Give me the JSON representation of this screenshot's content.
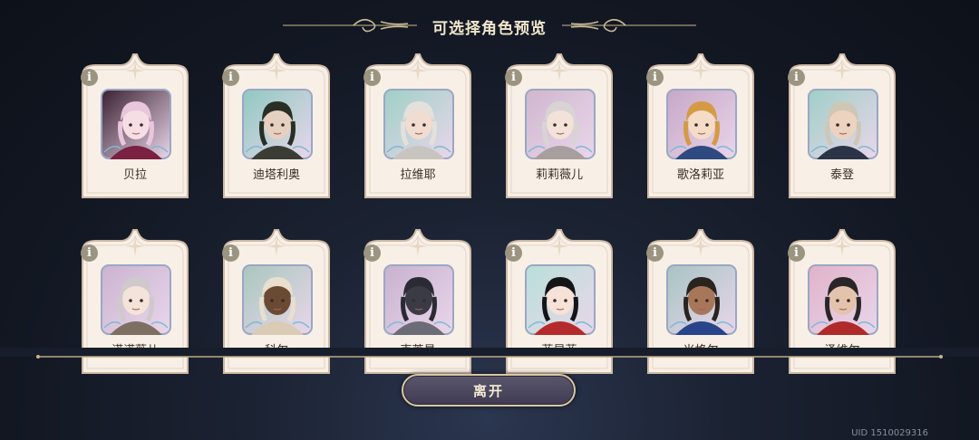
{
  "header": {
    "title": "可选择角色预览"
  },
  "characters_row1": [
    {
      "name": "贝拉",
      "info_label": "i",
      "portrait": "witch-pink-hair",
      "bg": "#3a2030",
      "hair": "#e8c6dc",
      "skin": "#f6dfe4",
      "accent": "#7a2040"
    },
    {
      "name": "迪塔利奥",
      "info_label": "i",
      "portrait": "dark-hair-man",
      "bg": "#8fc9c0",
      "hair": "#2a2f25",
      "skin": "#e6d0c0",
      "accent": "#3b3d35"
    },
    {
      "name": "拉维耶",
      "info_label": "i",
      "portrait": "white-hair-man",
      "bg": "#9ed0c6",
      "hair": "#e4e0dc",
      "skin": "#f0dcd0",
      "accent": "#c8c4c0"
    },
    {
      "name": "莉莉薇儿",
      "info_label": "i",
      "portrait": "silver-hair-fox-ears",
      "bg": "#cfb7ce",
      "hair": "#d8d4d4",
      "skin": "#f2e2d8",
      "accent": "#a89e9e"
    },
    {
      "name": "歌洛莉亚",
      "info_label": "i",
      "portrait": "blonde-woman",
      "bg": "#c6a7c7",
      "hair": "#d59a45",
      "skin": "#f4dcc6",
      "accent": "#2f4a80"
    },
    {
      "name": "泰登",
      "info_label": "i",
      "portrait": "grey-hair-knight",
      "bg": "#9fcfc7",
      "hair": "#cfc7b6",
      "skin": "#ecd3c0",
      "accent": "#2c3448"
    }
  ],
  "characters_row2": [
    {
      "name": "诺诺薇儿",
      "info_label": "i",
      "portrait": "silver-hair-cat-ears",
      "bg": "#cab3d0",
      "hair": "#cfc9cc",
      "skin": "#f3e3d8",
      "accent": "#7d6f62"
    },
    {
      "name": "科尔",
      "info_label": "i",
      "portrait": "hooded-dark-skin",
      "bg": "#a8c7bd",
      "hair": "#e8dfcf",
      "skin": "#6b4a33",
      "accent": "#d9cbb4"
    },
    {
      "name": "克莱曼",
      "info_label": "i",
      "portrait": "dark-armored-beast",
      "bg": "#c7b2cf",
      "hair": "#2a2b34",
      "skin": "#3a3b45",
      "accent": "#6b6c78"
    },
    {
      "name": "菲昂菲",
      "info_label": "i",
      "portrait": "black-hair-red-hood",
      "bg": "#b8e0d8",
      "hair": "#151517",
      "skin": "#f6e2d6",
      "accent": "#b52b2b"
    },
    {
      "name": "米格尔",
      "info_label": "i",
      "portrait": "bearded-man",
      "bg": "#a7c4c3",
      "hair": "#2a241f",
      "skin": "#a8775a",
      "accent": "#28448a"
    },
    {
      "name": "泽维尔",
      "info_label": "i",
      "portrait": "spiky-hair-red-armor",
      "bg": "#e0b3c9",
      "hair": "#2a2627",
      "skin": "#e4c3ad",
      "accent": "#b02a2a"
    }
  ],
  "footer": {
    "leave_label": "离开",
    "uid_text": "UID 1510029316"
  },
  "colors": {
    "card_bg": "#f8efe6",
    "card_border": "#cdb9a5",
    "gold": "#c9b48a"
  }
}
